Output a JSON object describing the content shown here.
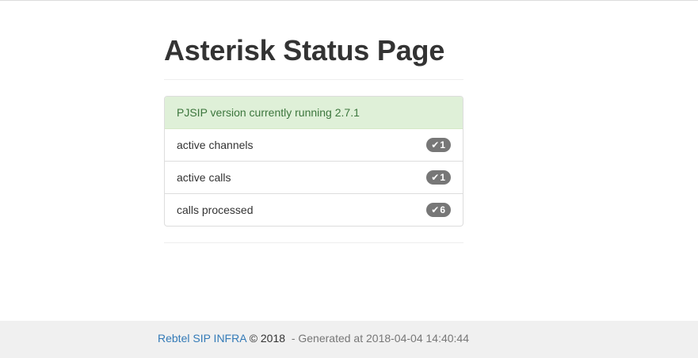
{
  "page": {
    "title": "Asterisk Status Page"
  },
  "status": {
    "heading": "PJSIP version currently running 2.7.1",
    "items": [
      {
        "label": "active channels",
        "badge_icon": "check-icon",
        "badge_value": "1"
      },
      {
        "label": "active calls",
        "badge_icon": "check-icon",
        "badge_value": "1"
      },
      {
        "label": "calls processed",
        "badge_icon": "check-icon",
        "badge_value": "6"
      }
    ]
  },
  "footer": {
    "link_text": "Rebtel SIP INFRA",
    "copyright": "© 2018",
    "generated_text": "- Generated at 2018-04-04 14:40:44"
  },
  "colors": {
    "heading_bg": "#dff0d8",
    "heading_text": "#3c763d",
    "badge_bg": "#777777",
    "link": "#337ab7",
    "footer_bg": "#f0f0f0"
  }
}
